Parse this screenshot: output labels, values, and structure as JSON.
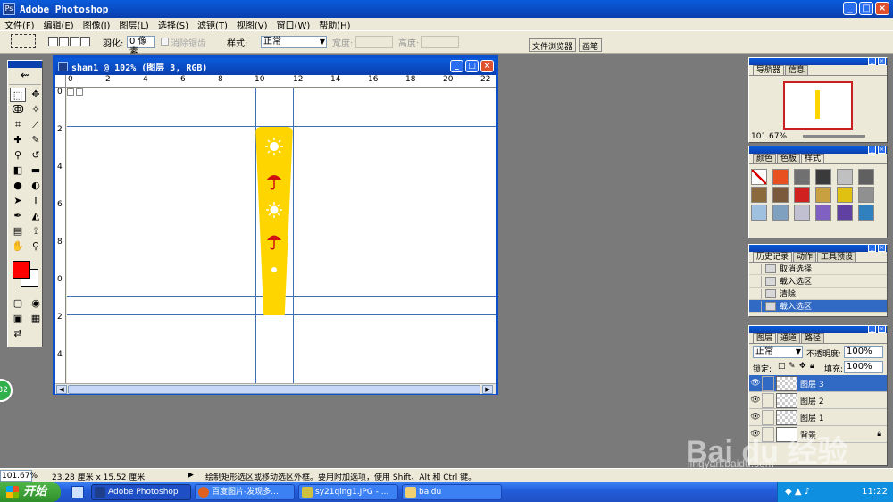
{
  "app": {
    "title": "Adobe Photoshop",
    "window_buttons": [
      "_",
      "□",
      "×"
    ]
  },
  "menu": [
    "文件(F)",
    "编辑(E)",
    "图像(I)",
    "图层(L)",
    "选择(S)",
    "滤镜(T)",
    "视图(V)",
    "窗口(W)",
    "帮助(H)"
  ],
  "options": {
    "feather_label": "羽化:",
    "feather_value": "0 像素",
    "antialias_label": "消除锯齿",
    "style_label": "样式:",
    "style_value": "正常",
    "width_label": "宽度:",
    "height_label": "高度:",
    "dock_tabs": [
      "文件浏览器",
      "画笔"
    ]
  },
  "document": {
    "title": "shan1 @ 102% (图层 3, RGB)",
    "ruler_h": [
      "0",
      "2",
      "4",
      "6",
      "8",
      "10",
      "12",
      "14",
      "16",
      "18",
      "20",
      "22"
    ],
    "ruler_v": [
      "0",
      "2",
      "4",
      "6",
      "8",
      "0",
      "2",
      "4"
    ]
  },
  "navigator": {
    "tabs": [
      "导航器",
      "信息"
    ],
    "zoom": "101.67%"
  },
  "swatch_panel": {
    "tabs": [
      "颜色",
      "色板",
      "样式"
    ],
    "colors": [
      "#ffffff",
      "#e85020",
      "#707070",
      "#3a3a3a",
      "#c0c0c0",
      "#606060",
      "#8a6a3a",
      "#7a5a3a",
      "#d02020",
      "#c8a040",
      "#e0c010",
      "#909090",
      "#a0c0e0",
      "#80a0c0",
      "#c0c0d0",
      "#8060c0",
      "#6040a0",
      "#3080c0"
    ]
  },
  "history": {
    "tabs": [
      "历史记录",
      "动作",
      "工具预设"
    ],
    "items": [
      "取消选择",
      "载入选区",
      "清除",
      "载入选区"
    ]
  },
  "layers": {
    "tabs": [
      "图层",
      "通道",
      "路径"
    ],
    "blend_mode": "正常",
    "opacity_label": "不透明度:",
    "opacity_value": "100%",
    "lock_label": "锁定:",
    "fill_label": "填充:",
    "fill_value": "100%",
    "items": [
      "图层 3",
      "图层 2",
      "图层 1",
      "背景"
    ]
  },
  "status": {
    "zoom": "101.67%",
    "doc_size": "23.28 厘米 x 15.52 厘米",
    "hint": "绘制矩形选区或移动选区外框。要用附加选项，使用 Shift、Alt 和 Ctrl 键。"
  },
  "taskbar": {
    "start": "开始",
    "items": [
      "Adobe Photoshop",
      "百度图片-发现多...",
      "sy21qing1.JPG - ...",
      "baidu"
    ],
    "clock": "11:22"
  },
  "watermark": {
    "brand": "Bai du 经验",
    "url": "jingyan.baidu.com"
  }
}
